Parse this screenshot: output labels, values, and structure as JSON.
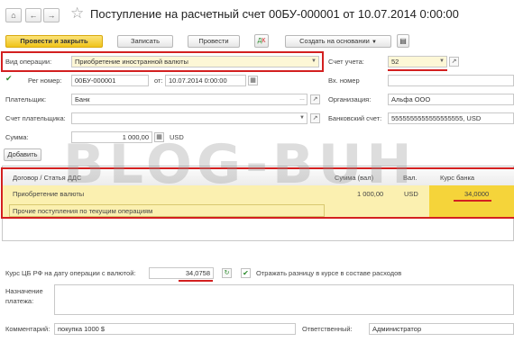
{
  "window": {
    "title": "Поступление на расчетный счет 00БУ-000001 от 10.07.2014 0:00:00"
  },
  "toolbar": {
    "post_close": "Провести и закрыть",
    "write": "Записать",
    "post": "Провести",
    "create_basis": "Создать на основании"
  },
  "form": {
    "op_type_label": "Вид операции:",
    "op_type_value": "Приобретение иностранной валюты",
    "account_label": "Счет учета:",
    "account_value": "52",
    "reg_num_label": "Рег номер:",
    "reg_num_value": "00БУ-000001",
    "from_label": "от:",
    "date_value": "10.07.2014  0:00:00",
    "in_num_label": "Вх. номер",
    "payer_label": "Плательщик:",
    "payer_value": "Банк",
    "org_label": "Организация:",
    "org_value": "Альфа ООО",
    "payer_acc_label": "Счет плательщика:",
    "bank_acc_label": "Банковский счет:",
    "bank_acc_value": "5555555555555555555, USD",
    "amount_label": "Сумма:",
    "amount_value": "1 000,00",
    "currency": "USD",
    "add_button": "Добавить"
  },
  "table": {
    "headers": [
      "Договор / Статья ДДС",
      "Сумма (вал)",
      "Вал.",
      "Курс банка"
    ],
    "row": {
      "contract": "Приобретение валюты",
      "amount": "1 000,00",
      "currency": "USD",
      "rate": "34,0000",
      "article": "Прочие поступления по текущим операциям"
    }
  },
  "footer": {
    "cb_rate_label": "Курс ЦБ РФ на дату операции с валютой:",
    "cb_rate_value": "34,0758",
    "reflect_label": "Отражать разницу в курсе в составе расходов",
    "reflect_checked": true,
    "purpose_label": "Назначение платежа:",
    "comment_label": "Комментарий:",
    "comment_value": "покупка 1000 $",
    "responsible_label": "Ответственный:",
    "responsible_value": "Администратор"
  },
  "watermark": "BLOG-BUH",
  "colors": {
    "accent_yellow": "#f5d43a",
    "highlight_red": "#d32020",
    "row_highlight": "#fbf0b0"
  }
}
